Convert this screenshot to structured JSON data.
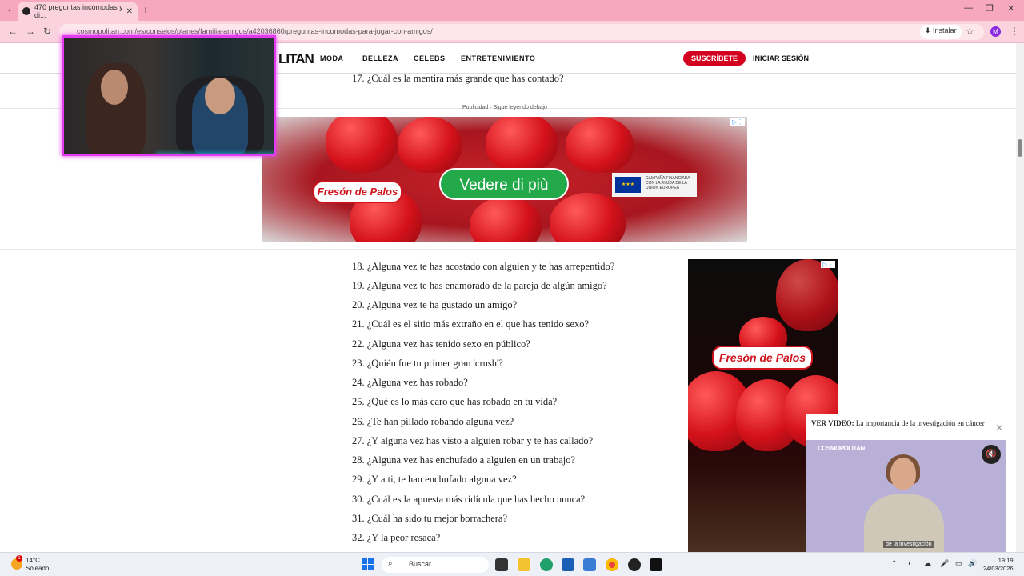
{
  "browser": {
    "tab_title": "470 preguntas incómodas y di...",
    "url": "cosmopolitan.com/es/consejos/planes/familia-amigos/a42036860/preguntas-incomodas-para-jugar-con-amigos/",
    "install_label": "Instalar",
    "profile_initial": "M"
  },
  "site": {
    "logo": "LITAN",
    "nav": [
      "MODA",
      "BELLEZA",
      "CELEBS",
      "ENTRETENIMIENTO"
    ],
    "subscribe_label": "SUSCRÍBETE",
    "login_label": "INICIAR SESIÓN"
  },
  "ad_label": "Publicidad · Sigue leyendo debajo",
  "banner_ad": {
    "brand": "Fresón de Palos",
    "cta": "Vedere di più",
    "eu_text": "CAMPAÑA FINANCIADA CON LA AYUDA DE LA UNIÓN EUROPEA"
  },
  "side_ad": {
    "brand": "Fresón de Palos"
  },
  "questions": [
    "17. ¿Cuál es la mentira más grande que has contado?",
    "18. ¿Alguna vez te has acostado con alguien y te has arrepentido?",
    "19. ¿Alguna vez te has enamorado de la pareja de algún amigo?",
    "20. ¿Alguna vez te ha gustado un amigo?",
    "21. ¿Cuál es el sitio más extraño en el que has tenido sexo?",
    "22. ¿Alguna vez has tenido sexo en público?",
    "23. ¿Quién fue tu primer gran 'crush'?",
    "24. ¿Alguna vez has robado?",
    "25. ¿Qué es lo más caro que has robado en tu vida?",
    "26. ¿Te han pillado robando alguna vez?",
    "27. ¿Y alguna vez has visto a alguien robar y te has callado?",
    "28. ¿Alguna vez has enchufado a alguien en un trabajo?",
    "29. ¿Y a ti, te han enchufado alguna vez?",
    "30. ¿Cuál es la apuesta más ridícula que has hecho nunca?",
    "31. ¿Cuál ha sido tu mejor borrachera?",
    "32. ¿Y la peor resaca?"
  ],
  "video": {
    "prefix": "VER VIDEO:",
    "title": "La importancia de la investigación en cáncer",
    "logo": "COSMOPOLITAN",
    "caption": "de la investigación"
  },
  "taskbar": {
    "temp": "14°C",
    "condition": "Soleado",
    "badge": "1",
    "search_label": "Buscar",
    "time": "19:19",
    "date": "24/03/2026"
  }
}
